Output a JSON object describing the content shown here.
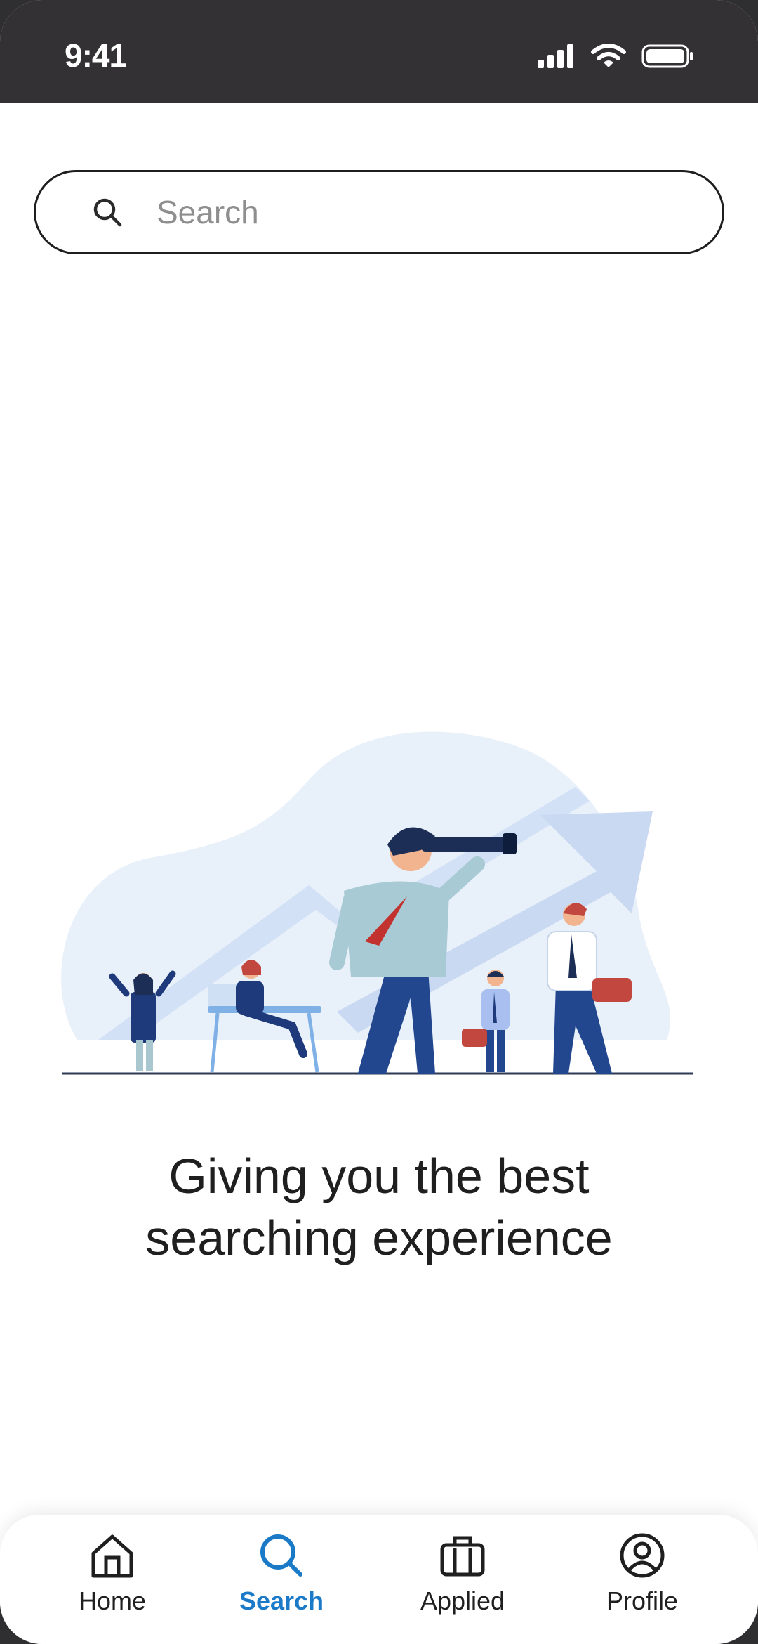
{
  "status_bar": {
    "time": "9:41",
    "icons": [
      "cellular-signal-icon",
      "wifi-icon",
      "battery-icon"
    ]
  },
  "search": {
    "placeholder": "Search",
    "icon": "search-icon"
  },
  "tagline": {
    "line1": "Giving you the best",
    "line2": "searching experience"
  },
  "bottom_nav": {
    "items": [
      {
        "label": "Home",
        "icon": "home-icon"
      },
      {
        "label": "Search",
        "icon": "search-icon",
        "active": true
      },
      {
        "label": "Applied",
        "icon": "briefcase-icon"
      },
      {
        "label": "Profile",
        "icon": "user-circle-icon"
      }
    ]
  },
  "colors": {
    "accent": "#1a7ac8",
    "status_bar": "#333133",
    "text": "#1f1f1f"
  }
}
